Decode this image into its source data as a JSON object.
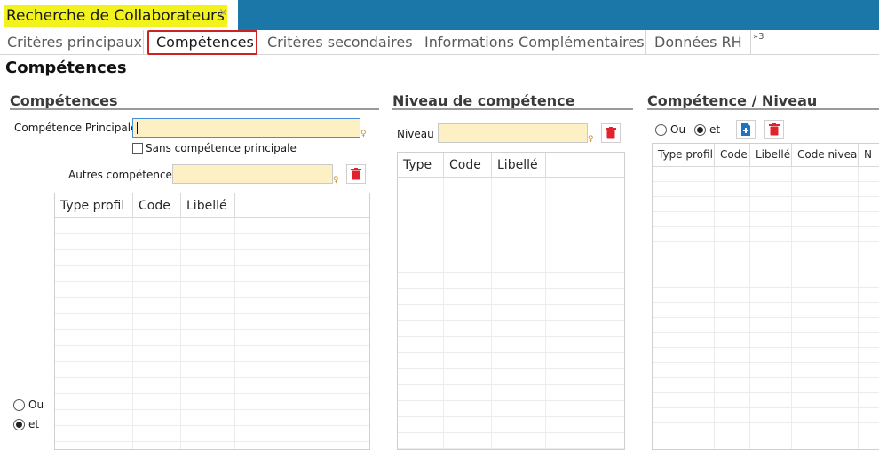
{
  "document_tab": {
    "title": "Recherche de Collaborateurs",
    "close_glyph": "×"
  },
  "tabs": [
    {
      "label": "Critères principaux"
    },
    {
      "label": "Compétences",
      "active": true
    },
    {
      "label": "Critères secondaires"
    },
    {
      "label": "Informations Complémentaires"
    },
    {
      "label": "Données RH"
    }
  ],
  "tabs_more": "»3",
  "page_title": "Compétences",
  "competences": {
    "title": "Compétences",
    "principale_label": "Compétence Principale",
    "principale_value": "",
    "sans_principale_label": "Sans compétence principale",
    "sans_principale_checked": false,
    "autres_label": "Autres compétences",
    "autres_value": "",
    "columns": [
      "Type profil",
      "Code",
      "Libellé",
      ""
    ],
    "radio_ou": "Ou",
    "radio_et": "et",
    "selected": "et"
  },
  "niveau": {
    "title": "Niveau de compétence",
    "niveau_label": "Niveau",
    "niveau_value": "",
    "columns": [
      "Type",
      "Code",
      "Libellé",
      ""
    ]
  },
  "comp_niveau": {
    "title": "Compétence / Niveau",
    "radio_ou": "Ou",
    "radio_et": "et",
    "selected": "et",
    "columns": [
      "Type profil",
      "Code",
      "Libellé",
      "Code niveau",
      "N"
    ]
  },
  "colors": {
    "titlebar": "#1a77a8",
    "title_highlight": "#f2f21c",
    "input_bg": "#fdf0c4",
    "delete_red": "#e0242d",
    "add_blue": "#1f73c4",
    "active_tab_border": "#cc2222"
  },
  "icons": {
    "delete": "trash-icon",
    "add": "add-document-icon",
    "lookup": "lookup-marker-icon"
  }
}
